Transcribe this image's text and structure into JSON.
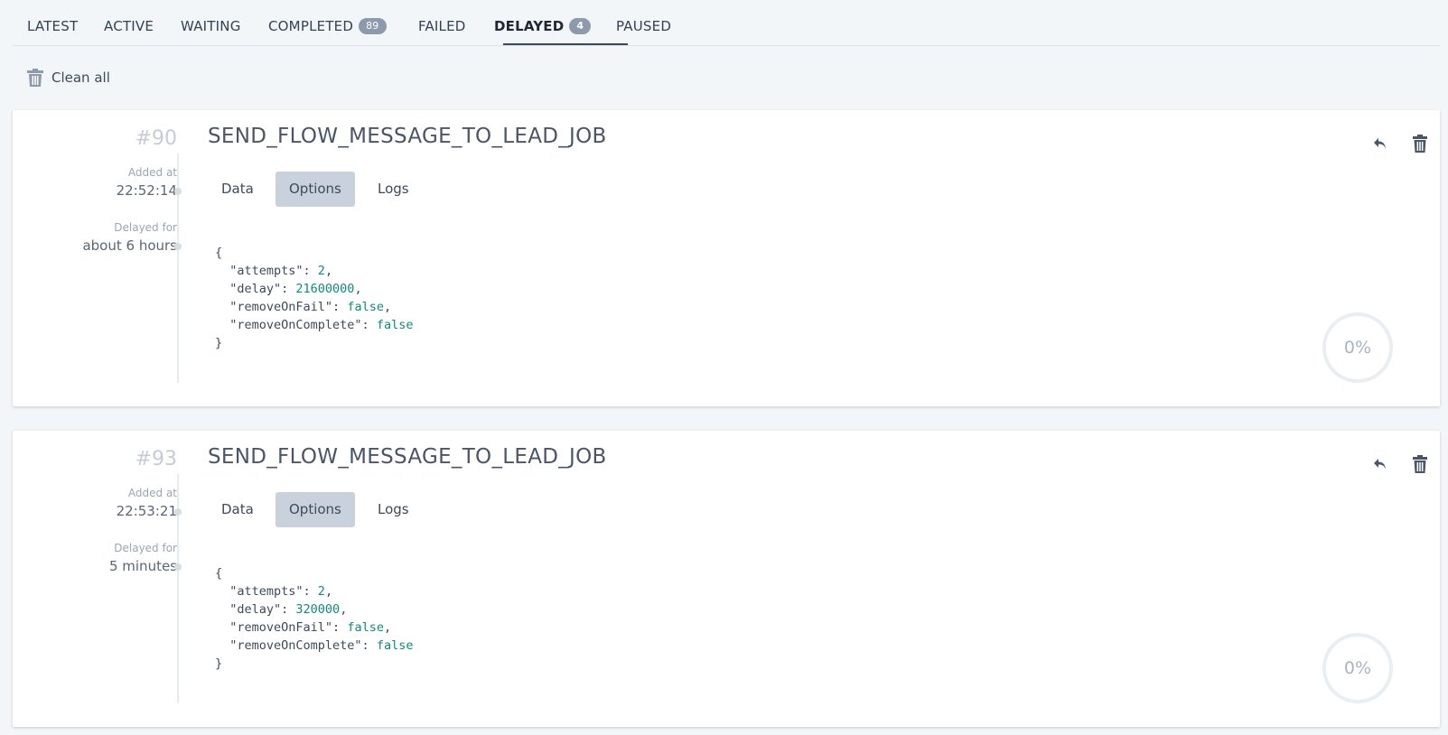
{
  "tabs": [
    {
      "label": "LATEST"
    },
    {
      "label": "ACTIVE"
    },
    {
      "label": "WAITING"
    },
    {
      "label": "COMPLETED",
      "badge": "89"
    },
    {
      "label": "FAILED"
    },
    {
      "label": "DELAYED",
      "badge": "4"
    },
    {
      "label": "PAUSED"
    }
  ],
  "active_tab": "DELAYED",
  "toolbar": {
    "clean_all_label": "Clean all"
  },
  "jobs": [
    {
      "id": "#90",
      "name": "SEND_FLOW_MESSAGE_TO_LEAD_JOB",
      "added_at_label": "Added at",
      "added_at": "22:52:14",
      "delayed_for_label": "Delayed for",
      "delayed_for": "about 6 hours",
      "sub_tabs": [
        "Data",
        "Options",
        "Logs"
      ],
      "selected_sub_tab": "Options",
      "options": {
        "attempts": "2",
        "delay": "21600000",
        "removeOnFail": "false",
        "removeOnComplete": "false"
      },
      "progress": "0%"
    },
    {
      "id": "#93",
      "name": "SEND_FLOW_MESSAGE_TO_LEAD_JOB",
      "added_at_label": "Added at",
      "added_at": "22:53:21",
      "delayed_for_label": "Delayed for",
      "delayed_for": "5 minutes",
      "sub_tabs": [
        "Data",
        "Options",
        "Logs"
      ],
      "selected_sub_tab": "Options",
      "options": {
        "attempts": "2",
        "delay": "320000",
        "removeOnFail": "false",
        "removeOnComplete": "false"
      },
      "progress": "0%"
    }
  ],
  "colors": {
    "accent_dark": "#3b4656",
    "badge": "#8d9aab",
    "json_value": "#0f8a7e",
    "selected_tab_bg": "#c9d2dc"
  },
  "icons": {
    "retry": "undo-arrow-icon",
    "delete": "trash-icon"
  }
}
